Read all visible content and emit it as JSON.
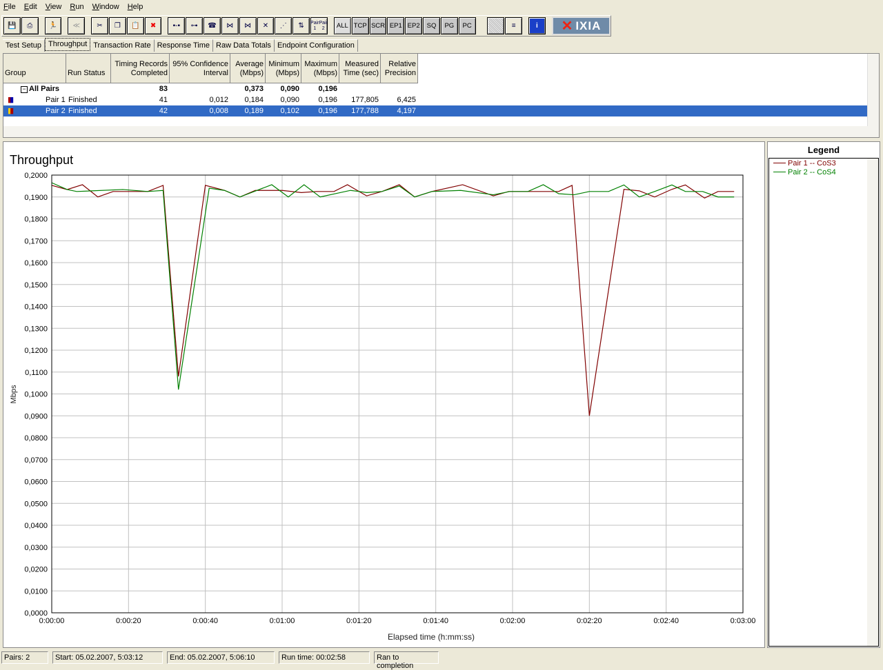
{
  "menu": [
    "File",
    "Edit",
    "View",
    "Run",
    "Window",
    "Help"
  ],
  "toolbar": {
    "buttons": [
      {
        "name": "save",
        "glyph": "💾"
      },
      {
        "name": "print",
        "glyph": "⎙"
      },
      {
        "name": "run",
        "glyph": "🏃"
      },
      {
        "name": "stop",
        "glyph": "≪"
      },
      {
        "name": "cut",
        "glyph": "✂"
      },
      {
        "name": "copy",
        "glyph": "❐"
      },
      {
        "name": "paste",
        "glyph": "📋"
      },
      {
        "name": "delete",
        "glyph": "✖"
      },
      {
        "name": "pair",
        "glyph": "▪-▪"
      },
      {
        "name": "multicast",
        "glyph": "⊶"
      },
      {
        "name": "voip",
        "glyph": "☎"
      },
      {
        "name": "group",
        "glyph": "⋈"
      },
      {
        "name": "voip-group",
        "glyph": "⋈"
      },
      {
        "name": "delete-pair",
        "glyph": "✕"
      },
      {
        "name": "network",
        "glyph": "⋰"
      },
      {
        "name": "swap",
        "glyph": "⇅"
      }
    ],
    "pair_button": [
      "Pair 1",
      "Pair 2"
    ],
    "filters": [
      "ALL",
      "TCP",
      "SCR",
      "EP1",
      "EP2",
      "SQ",
      "PG",
      "PC"
    ],
    "logo": "IXIA"
  },
  "tabs": [
    "Test Setup",
    "Throughput",
    "Transaction Rate",
    "Response Time",
    "Raw Data Totals",
    "Endpoint Configuration"
  ],
  "active_tab": "Throughput",
  "table": {
    "headers": [
      "Group",
      "Run Status",
      "Timing Records Completed",
      "95% Confidence Interval",
      "Average (Mbps)",
      "Minimum (Mbps)",
      "Maximum (Mbps)",
      "Measured Time (sec)",
      "Relative Precision"
    ],
    "summary": {
      "group": "All Pairs",
      "records": "83",
      "avg": "0,373",
      "min": "0,090",
      "max": "0,196"
    },
    "rows": [
      {
        "pair": "Pair 1",
        "status": "Finished",
        "records": "41",
        "ci": "0,012",
        "avg": "0,184",
        "min": "0,090",
        "max": "0,196",
        "time": "177,805",
        "precision": "6,425",
        "selected": false
      },
      {
        "pair": "Pair 2",
        "status": "Finished",
        "records": "42",
        "ci": "0,008",
        "avg": "0,189",
        "min": "0,102",
        "max": "0,196",
        "time": "177,788",
        "precision": "4,197",
        "selected": true
      }
    ]
  },
  "legend": {
    "title": "Legend",
    "items": [
      {
        "label": "Pair 1 -- CoS3",
        "color": "#800000"
      },
      {
        "label": "Pair 2 -- CoS4",
        "color": "#008000"
      }
    ]
  },
  "status": [
    "Pairs: 2",
    "Start: 05.02.2007, 5:03:12",
    "End: 05.02.2007, 5:06:10",
    "Run time: 00:02:58",
    "Ran to completion"
  ],
  "chart_data": {
    "type": "line",
    "title": "Throughput",
    "xlabel": "Elapsed time (h:mm:ss)",
    "ylabel": "Mbps",
    "xlim": [
      0,
      180
    ],
    "ylim": [
      0,
      0.2
    ],
    "xticks": [
      "0:00:00",
      "0:00:20",
      "0:00:40",
      "0:01:00",
      "0:01:20",
      "0:01:40",
      "0:02:00",
      "0:02:20",
      "0:02:40",
      "0:03:00"
    ],
    "yticks": [
      "0,0000",
      "0,0100",
      "0,0200",
      "0,0300",
      "0,0400",
      "0,0500",
      "0,0600",
      "0,0700",
      "0,0800",
      "0,0900",
      "0,1000",
      "0,1100",
      "0,1200",
      "0,1300",
      "0,1400",
      "0,1500",
      "0,1600",
      "0,1700",
      "0,1800",
      "0,1900",
      "0,2000"
    ],
    "grid": true,
    "series": [
      {
        "name": "Pair 1 -- CoS3",
        "color": "#800000",
        "x": [
          0,
          4,
          8,
          12,
          16,
          25,
          29,
          33,
          40,
          45,
          49,
          53,
          60,
          65,
          69,
          73.5,
          77,
          82,
          86,
          90.5,
          94.5,
          99,
          107,
          115,
          119,
          132,
          135.5,
          140,
          149,
          153,
          157,
          161.5,
          165,
          170,
          173.5,
          177.7
        ],
        "y": [
          0.1953,
          0.1934,
          0.1956,
          0.19,
          0.1925,
          0.1925,
          0.1953,
          0.108,
          0.1953,
          0.193,
          0.19,
          0.193,
          0.193,
          0.192,
          0.1925,
          0.1925,
          0.1956,
          0.1905,
          0.1925,
          0.1956,
          0.19,
          0.1925,
          0.1956,
          0.1905,
          0.1925,
          0.1925,
          0.1953,
          0.09,
          0.1935,
          0.1928,
          0.19,
          0.1935,
          0.1955,
          0.1895,
          0.1925,
          0.1925
        ]
      },
      {
        "name": "Pair 2 -- CoS4",
        "color": "#008000",
        "x": [
          0,
          4,
          6.5,
          18.5,
          25,
          29,
          33,
          41,
          45,
          49,
          57.3,
          61.6,
          65.7,
          69.9,
          77.8,
          80.1,
          82,
          86,
          90.5,
          94.5,
          99,
          106.5,
          115,
          119.3,
          124,
          128,
          132,
          136,
          140,
          145,
          149,
          153,
          157,
          161.5,
          165,
          169.5,
          173.5,
          177.7
        ],
        "y": [
          0.1965,
          0.1934,
          0.1925,
          0.1934,
          0.1925,
          0.193,
          0.102,
          0.194,
          0.193,
          0.19,
          0.1956,
          0.19,
          0.1956,
          0.19,
          0.193,
          0.1925,
          0.192,
          0.1925,
          0.195,
          0.19,
          0.1925,
          0.193,
          0.191,
          0.1925,
          0.1925,
          0.1956,
          0.1915,
          0.191,
          0.1925,
          0.1925,
          0.1955,
          0.19,
          0.1925,
          0.1955,
          0.1925,
          0.1925,
          0.19,
          0.19
        ]
      }
    ]
  }
}
